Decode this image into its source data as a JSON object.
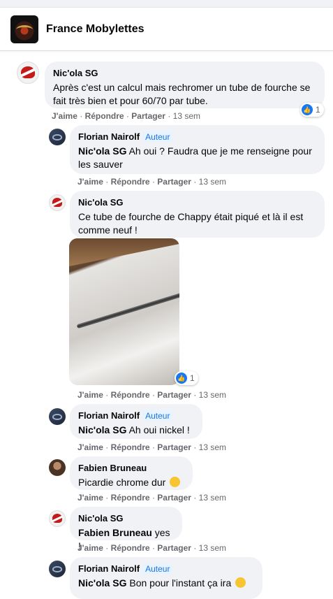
{
  "header": {
    "group_name": "France Mobylettes"
  },
  "comments": [
    {
      "author": "Nic'ola SG",
      "text": "Après c'est un calcul mais rechromer un tube de fourche se fait très bien et pour 60/70 par tube.",
      "reactions": "1"
    },
    {
      "author": "Florian Nairolf",
      "badge": "Auteur",
      "mention": "Nic'ola SG",
      "text": "Ah oui ? Faudra que je me renseigne pour les sauver"
    },
    {
      "author": "Nic'ola SG",
      "text": "Ce tube de fourche de Chappy était piqué et là il est comme neuf !",
      "photo_reactions": "1"
    },
    {
      "author": "Florian Nairolf",
      "badge": "Auteur",
      "mention": "Nic'ola SG",
      "text": "Ah oui nickel !"
    },
    {
      "author": "Fabien Bruneau",
      "text": "Picardie chrome dur"
    },
    {
      "author": "Nic'ola SG",
      "mention": "Fabien Bruneau",
      "text": "yes !"
    },
    {
      "author": "Florian Nairolf",
      "badge": "Auteur",
      "mention": "Nic'ola SG",
      "text": "Bon pour l'instant ça ira"
    }
  ],
  "actions": {
    "like": "J'aime",
    "reply": "Répondre",
    "share": "Partager",
    "time": "13 sem",
    "sep": "·"
  },
  "icons": {
    "like": "thumbs-up-icon",
    "emoji": "smiling-face-icon"
  },
  "colors": {
    "accent": "#1877f2",
    "bubble": "#f0f2f5",
    "meta": "#65676b"
  }
}
